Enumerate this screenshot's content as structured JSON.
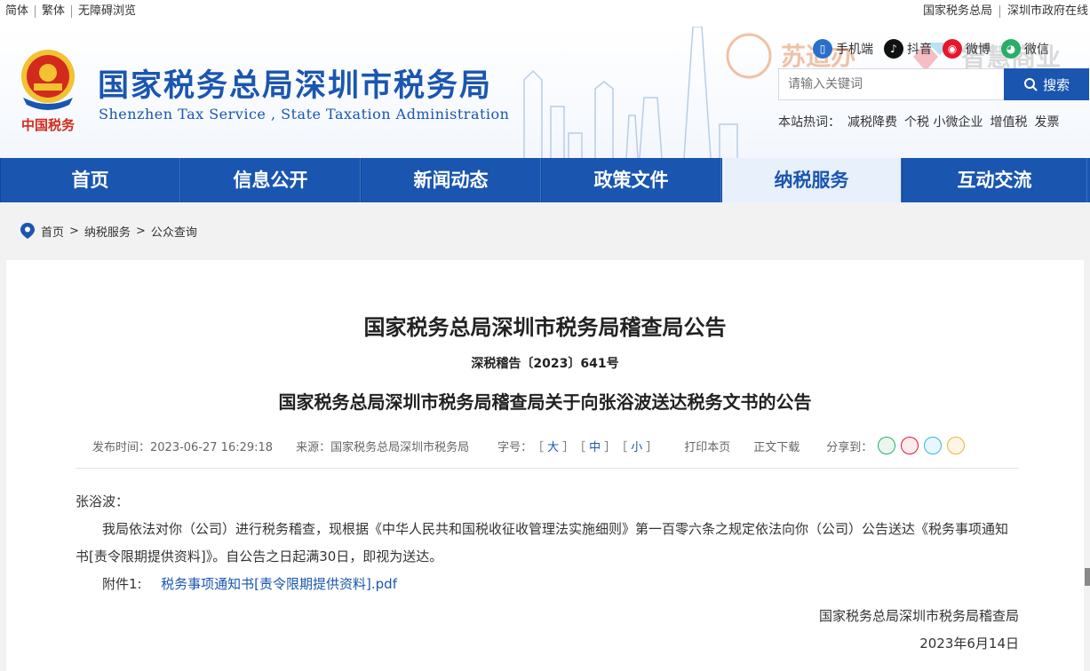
{
  "topbar": {
    "left": [
      "简体",
      "繁体",
      "无障碍浏览"
    ],
    "right": [
      "国家税务总局",
      "深圳市政府在线"
    ]
  },
  "header": {
    "title": "国家税务总局深圳市税务局",
    "subtitle": "Shenzhen Tax Service , State Taxation Administration",
    "emblem_text": "中国税务",
    "social": [
      "手机端",
      "抖音",
      "微博",
      "微信"
    ],
    "search_placeholder": "请输入关键词",
    "search_button": "搜索",
    "hot_label": "本站热词：",
    "hot_words": [
      "减税降费",
      "个税 小微企业",
      "增值税",
      "发票"
    ]
  },
  "nav": [
    "首页",
    "信息公开",
    "新闻动态",
    "政策文件",
    "纳税服务",
    "互动交流"
  ],
  "breadcrumb": [
    "首页",
    "纳税服务",
    "公众查询"
  ],
  "doc": {
    "title": "国家税务总局深圳市税务局稽查局公告",
    "number": "深税稽告〔2023〕641号",
    "subtitle": "国家税务总局深圳市税务局稽查局关于向张浴波送达税务文书的公告",
    "publish": "发布时间：2023-06-27 16:29:18",
    "source": "来源：国家税务总局深圳市税务局",
    "fontsize_label": "字号：",
    "size_large": "大",
    "size_mid": "中",
    "size_small": "小",
    "print": "打印本页",
    "download": "正文下载",
    "share": "分享到：",
    "salutation": "张浴波：",
    "paragraph": "我局依法对你（公司）进行税务稽查，现根据《中华人民共和国税收征收管理法实施细则》第一百零六条之规定依法向你（公司）公告送达《税务事项通知书[责令限期提供资料]》。自公告之日起满30日，即视为送达。",
    "attachment_label": "附件1:",
    "attachment_link": "税务事项通知书[责令限期提供资料].pdf",
    "sign_org": "国家税务总局深圳市税务局稽查局",
    "sign_date": "2023年6月14日"
  },
  "colors": {
    "brand": "#1a56b0",
    "active_tab_bg": "#e8f0fb"
  }
}
